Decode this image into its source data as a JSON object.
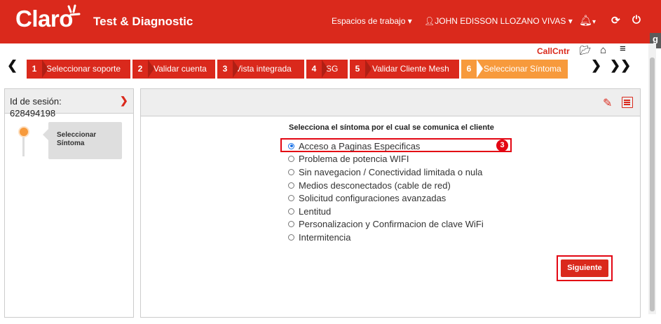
{
  "topbar": {
    "logo": "Claro",
    "app_title": "Test & Diagnostic",
    "workspaces": "Espacios de trabajo",
    "user": "JOHN EDISSON LLOZANO VIVAS",
    "badge_letter": "g"
  },
  "steps": [
    {
      "num": "1",
      "label": "Seleccionar soporte"
    },
    {
      "num": "2",
      "label": "Validar cuenta"
    },
    {
      "num": "3",
      "label": "Vista integrada"
    },
    {
      "num": "4",
      "label": "SG"
    },
    {
      "num": "5",
      "label": "Validar Cliente Mesh"
    },
    {
      "num": "6",
      "label": "Seleccionar Síntoma"
    }
  ],
  "toolbar": {
    "callcntr": "CallCntr"
  },
  "session": {
    "label": "Id de sesión:",
    "id": "628494198",
    "timeline_step": "Seleccionar Síntoma"
  },
  "main": {
    "question": "Selecciona el síntoma por el cual se comunica el cliente",
    "options": [
      "Acceso a Paginas Especificas",
      "Problema de potencia WIFI",
      "Sin navegacion / Conectividad limitada o nula",
      "Medios desconectados (cable de red)",
      "Solicitud configuraciones avanzadas",
      "Lentitud",
      "Personalizacion y Confirmacion de clave WiFi",
      "Intermitencia"
    ],
    "selected_index": 0,
    "annotation_badge": "3",
    "next_button": "Siguiente"
  },
  "colors": {
    "brand_red": "#da291c",
    "active_step": "#f79a3c",
    "highlight": "#e30613"
  }
}
